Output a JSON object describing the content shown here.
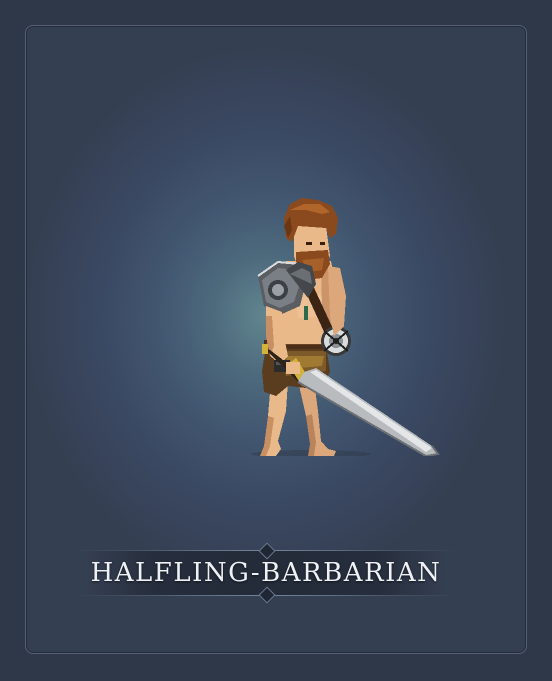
{
  "character": {
    "name": "HALFLING-BARBARIAN"
  },
  "colors": {
    "background": "#2f3848",
    "card_glow": "#62868f",
    "title_text": "#eef1f5",
    "skin": "#e9b98a",
    "hair": "#8a4a1e",
    "sword_blade": "#b9bcbf",
    "armor": "#5a5e63"
  },
  "icons": {
    "character": "barbarian-sprite",
    "ornament": "diamond-ornament"
  }
}
